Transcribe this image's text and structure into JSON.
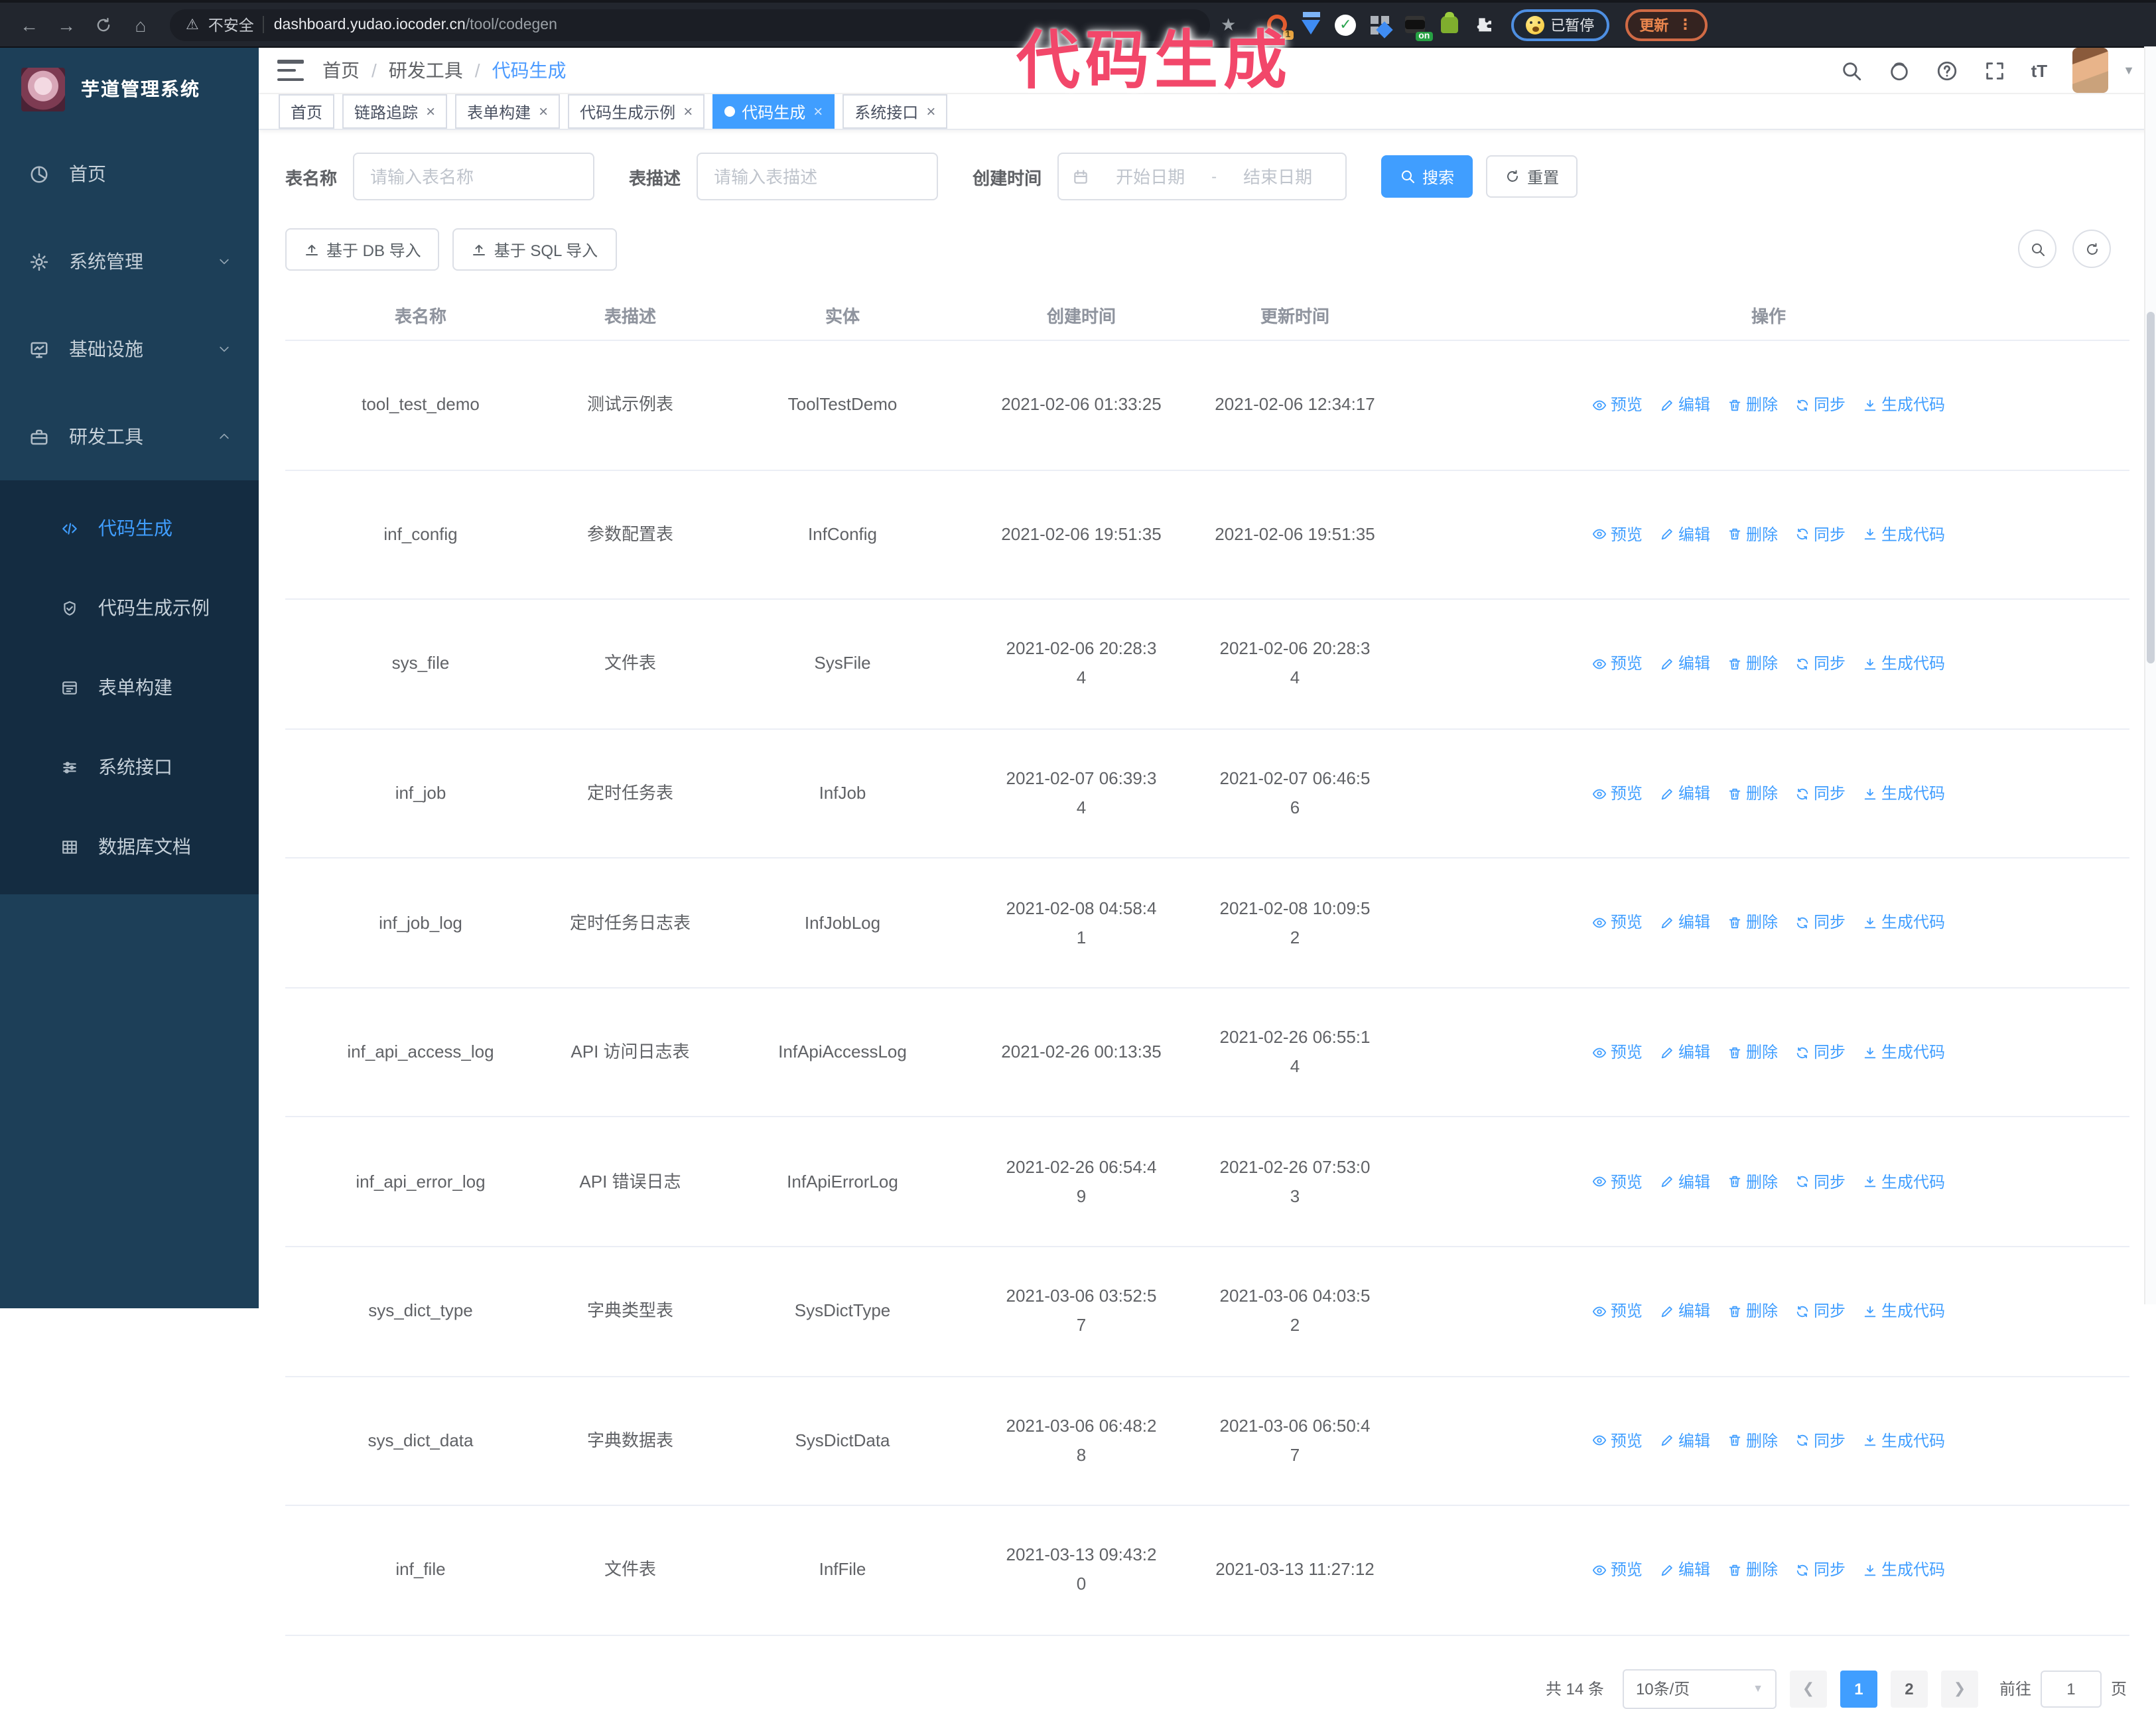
{
  "colors": {
    "accent": "#409EFF",
    "overlay_pink": "#F2476A",
    "sidebar_bg": "#1D3F58",
    "submenu_bg": "#142C41"
  },
  "browser": {
    "security_label": "不安全",
    "url_host": "dashboard.yudao.iocoder.cn",
    "url_path": "/tool/codegen",
    "extension_badge": "1",
    "extension_on_badge": "on",
    "paused_badge": "已暂停",
    "update_button": "更新",
    "update_dots": "⋮"
  },
  "overlay": {
    "text": "代码生成"
  },
  "sidebar": {
    "title": "芋道管理系统",
    "items": [
      {
        "label": "首页",
        "icon": "dashboard-icon"
      },
      {
        "label": "系统管理",
        "icon": "gear-icon",
        "chevron": "down"
      },
      {
        "label": "基础设施",
        "icon": "monitor-icon",
        "chevron": "down"
      },
      {
        "label": "研发工具",
        "icon": "toolbox-icon",
        "chevron": "up"
      }
    ],
    "subitems": [
      {
        "label": "代码生成",
        "icon": "code-icon",
        "active": true
      },
      {
        "label": "代码生成示例",
        "icon": "badge-check-icon"
      },
      {
        "label": "表单构建",
        "icon": "form-icon"
      },
      {
        "label": "系统接口",
        "icon": "sliders-icon"
      },
      {
        "label": "数据库文档",
        "icon": "table-grid-icon"
      }
    ]
  },
  "breadcrumb": {
    "separator": "/",
    "items": [
      "首页",
      "研发工具",
      "代码生成"
    ]
  },
  "tabs": [
    {
      "label": "首页",
      "closable": false,
      "active": false
    },
    {
      "label": "链路追踪",
      "closable": true,
      "active": false
    },
    {
      "label": "表单构建",
      "closable": true,
      "active": false
    },
    {
      "label": "代码生成示例",
      "closable": true,
      "active": false
    },
    {
      "label": "代码生成",
      "closable": true,
      "active": true
    },
    {
      "label": "系统接口",
      "closable": true,
      "active": false
    }
  ],
  "filters": {
    "name_label": "表名称",
    "name_placeholder": "请输入表名称",
    "desc_label": "表描述",
    "desc_placeholder": "请输入表描述",
    "time_label": "创建时间",
    "start_placeholder": "开始日期",
    "range_separator": "-",
    "end_placeholder": "结束日期",
    "search_label": "搜索",
    "reset_label": "重置"
  },
  "toolbar": {
    "import_db_label": "基于 DB 导入",
    "import_sql_label": "基于 SQL 导入"
  },
  "table": {
    "columns": [
      "表名称",
      "表描述",
      "实体",
      "创建时间",
      "更新时间",
      "操作"
    ],
    "actions": [
      "预览",
      "编辑",
      "删除",
      "同步",
      "生成代码"
    ],
    "rows": [
      {
        "name": "tool_test_demo",
        "desc": "测试示例表",
        "entity": "ToolTestDemo",
        "created": "2021-02-06 01:33:25",
        "updated": "2021-02-06 12:34:17"
      },
      {
        "name": "inf_config",
        "desc": "参数配置表",
        "entity": "InfConfig",
        "created": "2021-02-06 19:51:35",
        "updated": "2021-02-06 19:51:35"
      },
      {
        "name": "sys_file",
        "desc": "文件表",
        "entity": "SysFile",
        "created": "2021-02-06 20:28:3\n4",
        "updated": "2021-02-06 20:28:3\n4"
      },
      {
        "name": "inf_job",
        "desc": "定时任务表",
        "entity": "InfJob",
        "created": "2021-02-07 06:39:3\n4",
        "updated": "2021-02-07 06:46:5\n6"
      },
      {
        "name": "inf_job_log",
        "desc": "定时任务日志表",
        "entity": "InfJobLog",
        "created": "2021-02-08 04:58:4\n1",
        "updated": "2021-02-08 10:09:5\n2"
      },
      {
        "name": "inf_api_access_log",
        "desc": "API 访问日志表",
        "entity": "InfApiAccessLog",
        "created": "2021-02-26 00:13:35",
        "updated": "2021-02-26 06:55:1\n4"
      },
      {
        "name": "inf_api_error_log",
        "desc": "API 错误日志",
        "entity": "InfApiErrorLog",
        "created": "2021-02-26 06:54:4\n9",
        "updated": "2021-02-26 07:53:0\n3"
      },
      {
        "name": "sys_dict_type",
        "desc": "字典类型表",
        "entity": "SysDictType",
        "created": "2021-03-06 03:52:5\n7",
        "updated": "2021-03-06 04:03:5\n2"
      },
      {
        "name": "sys_dict_data",
        "desc": "字典数据表",
        "entity": "SysDictData",
        "created": "2021-03-06 06:48:2\n8",
        "updated": "2021-03-06 06:50:4\n7"
      },
      {
        "name": "inf_file",
        "desc": "文件表",
        "entity": "InfFile",
        "created": "2021-03-13 09:43:2\n0",
        "updated": "2021-03-13 11:27:12"
      }
    ]
  },
  "pagination": {
    "total": "共 14 条",
    "page_size": "10条/页",
    "pages": [
      "1",
      "2"
    ],
    "active_page": "1",
    "goto_label": "前往",
    "goto_value": "1",
    "page_unit": "页"
  }
}
